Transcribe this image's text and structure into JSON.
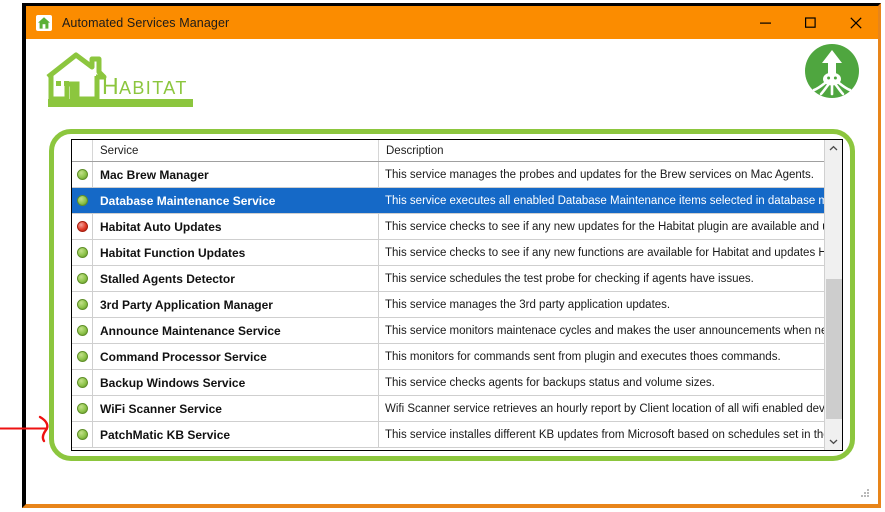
{
  "window": {
    "title": "Automated Services Manager",
    "app_icon": "house-icon",
    "minimize_label": "Minimize",
    "maximize_label": "Maximize",
    "close_label": "Close",
    "titlebar_color": "#fb8c00",
    "border_color_left": "#000000",
    "border_color_accent": "#e8851a"
  },
  "branding": {
    "logo_text": "HABITAT",
    "logo_color": "#8cc63e",
    "corner_logo": "squid-logo",
    "corner_logo_color": "#4fa63f"
  },
  "panel": {
    "border_color": "#8cc63e"
  },
  "grid": {
    "columns": {
      "status": "",
      "service": "Service",
      "description": "Description"
    },
    "selected_index": 1,
    "selection_color": "#1569c7",
    "rows": [
      {
        "status": "green",
        "service": "Mac Brew Manager",
        "description": "This service manages the probes and updates for the Brew services on Mac Agents."
      },
      {
        "status": "green",
        "service": "Database Maintenance Service",
        "description": "This service executes all enabled Database Maintenance items selected in database maintena..."
      },
      {
        "status": "red",
        "service": "Habitat Auto Updates",
        "description": "This service checks to see if any new updates for the Habitat plugin are available and updates..."
      },
      {
        "status": "green",
        "service": "Habitat Function Updates",
        "description": "This service checks to see if any new functions are available for Habitat and updates Habitat if..."
      },
      {
        "status": "green",
        "service": "Stalled Agents Detector",
        "description": "This service schedules the test probe for checking if agents have issues."
      },
      {
        "status": "green",
        "service": "3rd Party Application Manager",
        "description": "This service manages the 3rd party application updates."
      },
      {
        "status": "green",
        "service": "Announce Maintenance Service",
        "description": "This service monitors maintenace cycles and makes the user announcements when needed."
      },
      {
        "status": "green",
        "service": "Command Processor Service",
        "description": "This monitors for commands sent from plugin and executes thoes commands."
      },
      {
        "status": "green",
        "service": "Backup Windows Service",
        "description": "This service checks agents for backups status and volume sizes."
      },
      {
        "status": "green",
        "service": "WiFi Scanner Service",
        "description": "Wifi Scanner service retrieves an hourly report by Client location of all wifi enabled devices"
      },
      {
        "status": "green",
        "service": "PatchMatic KB Service",
        "description": "This service installes different KB updates from Microsoft based on schedules set in the client c..."
      }
    ]
  },
  "scrollbar": {
    "up_arrow": "chevron-up-icon",
    "down_arrow": "chevron-down-icon"
  },
  "annotation": {
    "arrow_color": "#ee1111",
    "points_at": "PatchMatic KB Service"
  }
}
